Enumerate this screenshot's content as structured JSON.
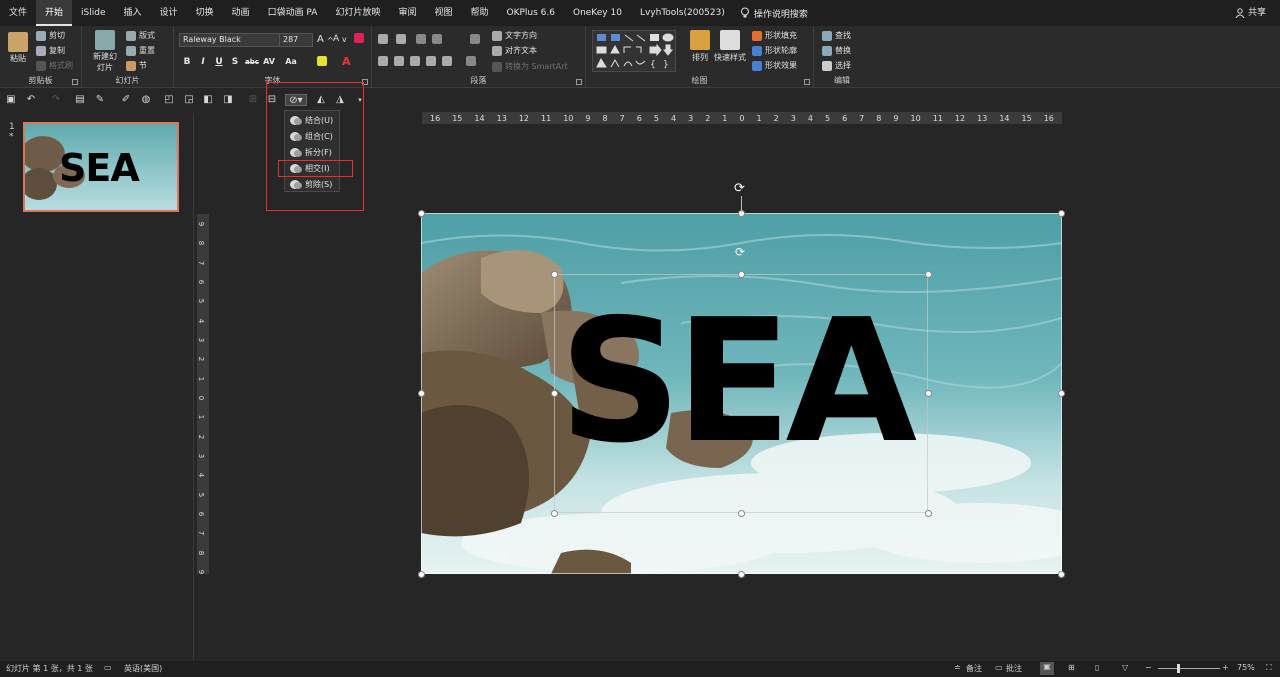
{
  "menu": {
    "tabs": [
      "文件",
      "开始",
      "iSlide",
      "插入",
      "设计",
      "切换",
      "动画",
      "口袋动画 PA",
      "幻灯片放映",
      "审阅",
      "视图",
      "帮助",
      "OKPlus 6.6",
      "OneKey 10",
      "LvyhTools(200523)"
    ],
    "active": "开始",
    "search_label": "操作说明搜索",
    "share_label": "共享"
  },
  "ribbon": {
    "clipboard": {
      "label": "剪贴板",
      "paste": "粘贴",
      "cut": "剪切",
      "copy": "复制",
      "format_painter": "格式刷"
    },
    "slides": {
      "label": "幻灯片",
      "new_slide": "新建幻灯片",
      "layout": "版式",
      "reset": "重置",
      "section": "节"
    },
    "font": {
      "label": "字体",
      "font_name": "Raleway Black",
      "font_size": "287",
      "bold": "B",
      "italic": "I",
      "underline": "U",
      "shadow": "S",
      "strike": "abc",
      "spacing": "AV",
      "case": "Aa"
    },
    "paragraph": {
      "label": "段落",
      "text_direction": "文字方向",
      "align_text": "对齐文本",
      "smartart": "转换为 SmartArt"
    },
    "drawing": {
      "label": "绘图",
      "arrange": "排列",
      "quick_styles": "快速样式",
      "fill": "形状填充",
      "outline": "形状轮廓",
      "effects": "形状效果"
    },
    "editing": {
      "label": "编辑",
      "find": "查找",
      "replace": "替换",
      "select": "选择"
    }
  },
  "merge_menu": {
    "items": [
      "结合(U)",
      "组合(C)",
      "拆分(F)",
      "相交(I)",
      "剪除(S)"
    ],
    "highlighted": "相交(I)"
  },
  "slides_pane": {
    "slide_number": "1",
    "star": "*",
    "thumb_text": "SEA"
  },
  "slide": {
    "text": "SEA"
  },
  "ruler": {
    "h_ticks": [
      "16",
      "15",
      "14",
      "13",
      "12",
      "11",
      "10",
      "9",
      "8",
      "7",
      "6",
      "5",
      "4",
      "3",
      "2",
      "1",
      "0",
      "1",
      "2",
      "3",
      "4",
      "5",
      "6",
      "7",
      "8",
      "9",
      "10",
      "11",
      "12",
      "13",
      "14",
      "15",
      "16"
    ],
    "v_ticks": [
      "9",
      "8",
      "7",
      "6",
      "5",
      "4",
      "3",
      "2",
      "1",
      "0",
      "1",
      "2",
      "3",
      "4",
      "5",
      "6",
      "7",
      "8",
      "9"
    ]
  },
  "status": {
    "slide_info": "幻灯片 第 1 张，共 1 张",
    "language": "英语(美国)",
    "notes": "备注",
    "comments": "批注",
    "zoom": "75%"
  },
  "colors": {
    "accent_red": "#e0322f",
    "thumb_border": "#d87860",
    "sea": "#5fa9ae",
    "rock": "#7a6650"
  }
}
